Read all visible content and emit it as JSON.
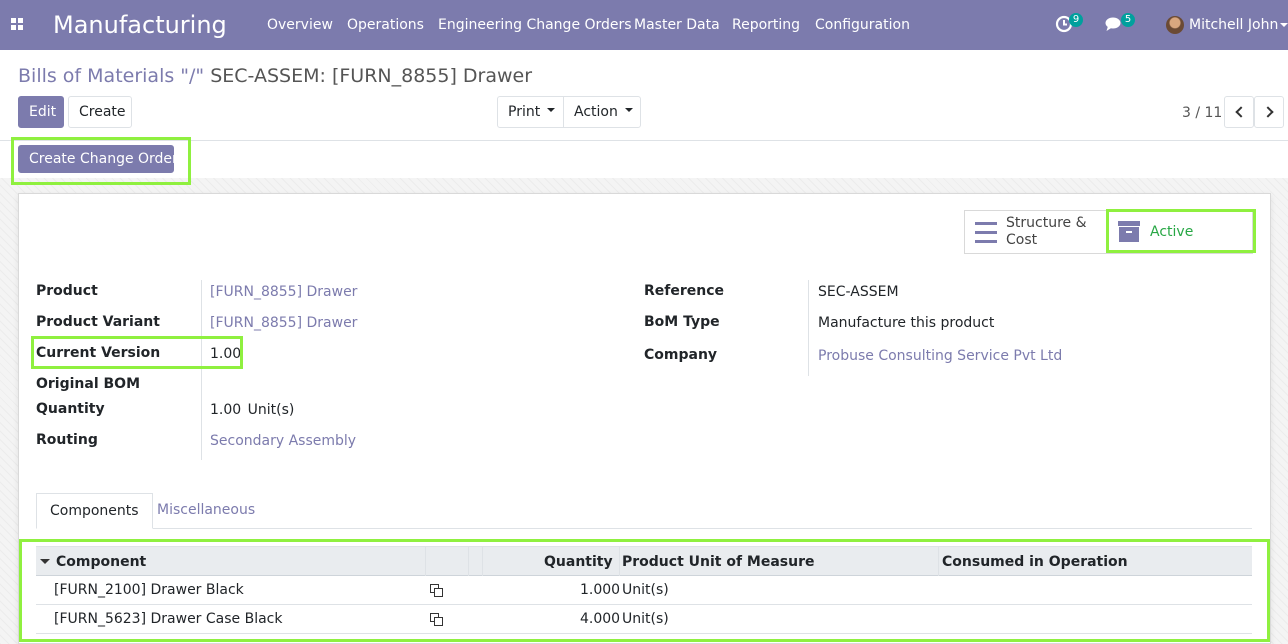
{
  "navbar": {
    "app_title": "Manufacturing",
    "menu": [
      "Overview",
      "Operations",
      "Engineering Change Orders",
      "Master Data",
      "Reporting",
      "Configuration"
    ],
    "activity_count": "9",
    "message_count": "5",
    "user_name": "Mitchell John",
    "accent_color": "#7c7bad",
    "badge_color": "#00a09d"
  },
  "breadcrumb": {
    "parent": "Bills of Materials",
    "separator": " \"/\" ",
    "current": "SEC-ASSEM: [FURN_8855] Drawer"
  },
  "toolbar": {
    "edit": "Edit",
    "create": "Create",
    "print": "Print",
    "action": "Action"
  },
  "pager": {
    "value": "3 / 11"
  },
  "statusbar": {
    "create_change_order": "Create Change Order"
  },
  "smart_buttons": {
    "structure_cost": [
      "Structure &",
      "Cost"
    ],
    "active": "Active",
    "active_color": "#28a745"
  },
  "form": {
    "product_label": "Product",
    "product_value": "[FURN_8855] Drawer",
    "variant_label": "Product Variant",
    "variant_value": "[FURN_8855] Drawer",
    "version_label": "Current Version",
    "version_value": "1.00",
    "original_bom_label": "Original BOM",
    "quantity_label": "Quantity",
    "quantity_value": "1.00",
    "quantity_uom": "Unit(s)",
    "routing_label": "Routing",
    "routing_value": "Secondary Assembly",
    "reference_label": "Reference",
    "reference_value": "SEC-ASSEM",
    "bom_type_label": "BoM Type",
    "bom_type_value": "Manufacture this product",
    "company_label": "Company",
    "company_value": "Probuse Consulting Service Pvt Ltd"
  },
  "tabs": {
    "components": "Components",
    "misc": "Miscellaneous"
  },
  "table": {
    "headers": {
      "component": "Component",
      "quantity": "Quantity",
      "uom": "Product Unit of Measure",
      "operation": "Consumed in Operation"
    },
    "rows": [
      {
        "component": "[FURN_2100] Drawer Black",
        "quantity": "1.000",
        "uom": "Unit(s)",
        "operation": ""
      },
      {
        "component": "[FURN_5623] Drawer Case Black",
        "quantity": "4.000",
        "uom": "Unit(s)",
        "operation": ""
      }
    ]
  },
  "highlight_color": "#8ff03f"
}
